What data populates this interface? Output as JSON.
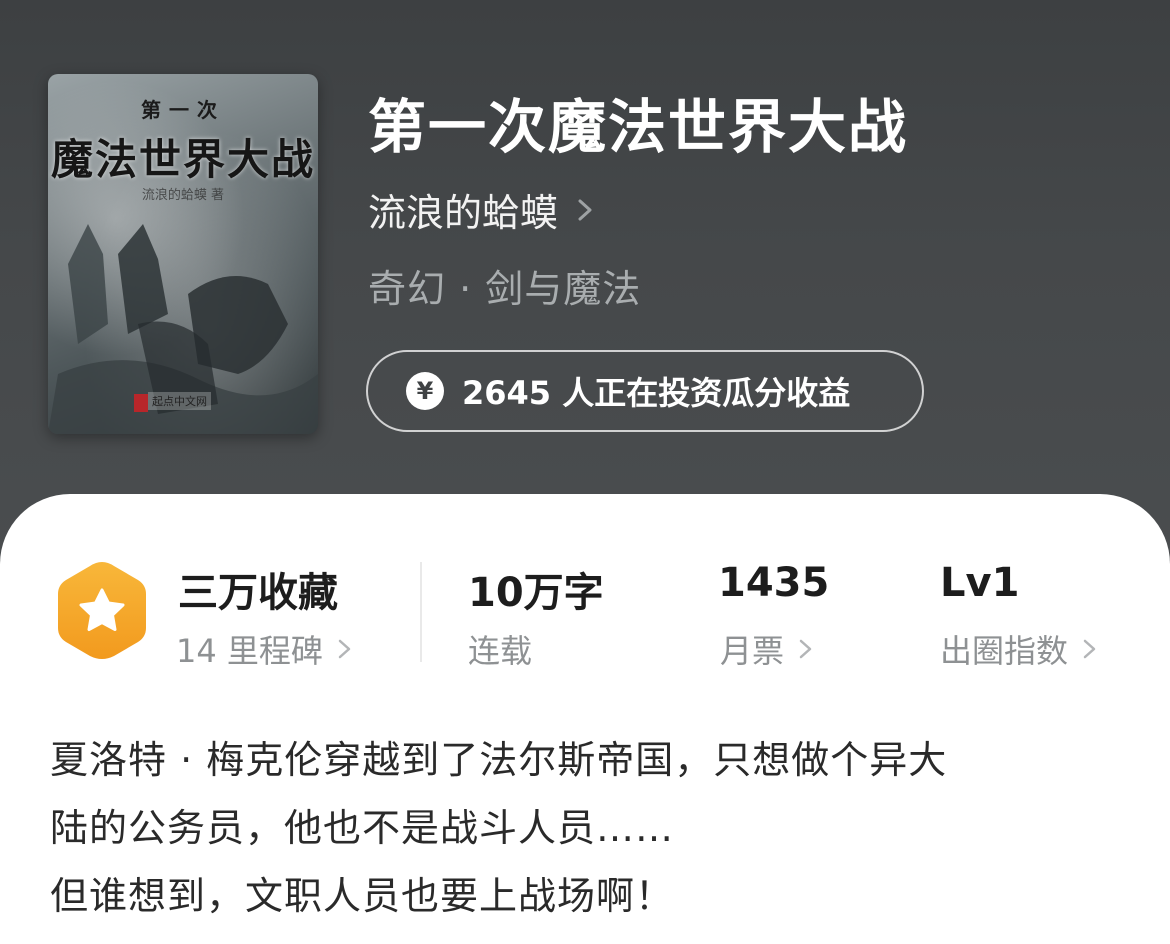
{
  "cover": {
    "small_text": "第一次",
    "title_text": "魔法世界大战",
    "author_text": "流浪的蛤蟆 著",
    "publisher_text": "起点中文网"
  },
  "book": {
    "title": "第一次魔法世界大战",
    "author": "流浪的蛤蟆",
    "genre": "奇幻 · 剑与魔法"
  },
  "invest": {
    "icon": "yen-icon",
    "icon_glyph": "¥",
    "label": "2645 人正在投资瓜分收益"
  },
  "stats": {
    "badge_icon": "star-badge-icon",
    "collect_main": "三万收藏",
    "collect_sub": "14 里程碑",
    "words_main": "10万字",
    "words_sub": "连载",
    "tickets_main": "1435",
    "tickets_sub": "月票",
    "level_main": "Lv1",
    "level_sub": "出圈指数"
  },
  "description": [
    "夏洛特 · 梅克伦穿越到了法尔斯帝国，只想做个异大",
    "陆的公务员，他也不是战斗人员……",
    "但谁想到，文职人员也要上战场啊！"
  ],
  "colors": {
    "hero_bg": "#3f4244",
    "badge_orange": "#f6a623",
    "panel_bg": "#ffffff",
    "muted_text": "#8e9193"
  }
}
